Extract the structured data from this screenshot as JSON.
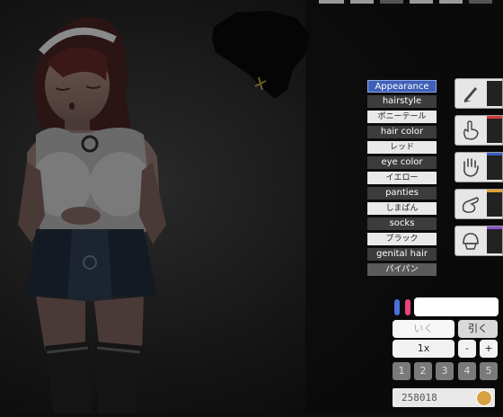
{
  "menu": {
    "header": "Appearance",
    "items": [
      {
        "category": "hairstyle",
        "value": "ポニーテール"
      },
      {
        "category": "hair color",
        "value": "レッド"
      },
      {
        "category": "eye color",
        "value": "イエロー"
      },
      {
        "category": "panties",
        "value": "しまぱん"
      },
      {
        "category": "socks",
        "value": "ブラック"
      },
      {
        "category": "genital hair",
        "value": "パイパン"
      }
    ]
  },
  "tools": [
    {
      "icon": "cursor-icon",
      "stripe": "#e6e6e6"
    },
    {
      "icon": "finger-poke-icon",
      "stripe": "#d63a3a"
    },
    {
      "icon": "open-hand-icon",
      "stripe": "#3a5fc8"
    },
    {
      "icon": "pinch-hand-icon",
      "stripe": "#e0a030"
    },
    {
      "icon": "cap-hand-icon",
      "stripe": "#8a55c8"
    }
  ],
  "controls": {
    "color_picks": [
      "#4a6fd8",
      "#e8447a"
    ],
    "go_label": "いく",
    "pull_label": "引く",
    "speed_label": "1x",
    "minus_label": "-",
    "plus_label": "+",
    "presets": [
      "1",
      "2",
      "3",
      "4",
      "5"
    ]
  },
  "status": {
    "value": "258018",
    "icon": "coin-icon"
  }
}
